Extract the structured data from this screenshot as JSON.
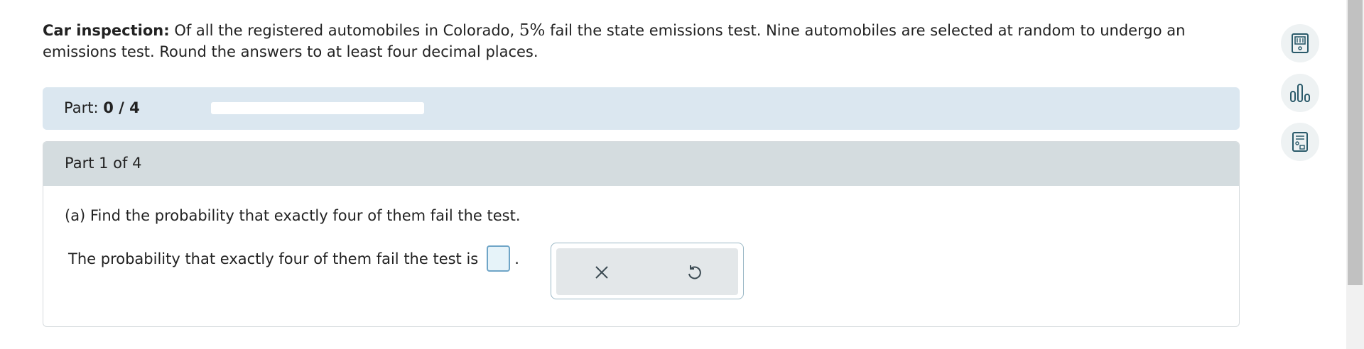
{
  "problem": {
    "title": "Car inspection:",
    "text_before": "Of all the registered automobiles in Colorado,",
    "percent": "5%",
    "text_after": "fail the state emissions test. Nine automobiles are selected at random to undergo an emissions test. Round the answers to at least four decimal places."
  },
  "progress": {
    "label": "Part:",
    "value": "0 / 4",
    "fraction": 0
  },
  "part": {
    "header": "Part 1 of 4",
    "question": "(a) Find the probability that exactly four of them fail the test.",
    "answer_prompt": "The probability that exactly four of them fail the test is",
    "answer_value": "",
    "period": "."
  },
  "tools": {
    "clear_icon": "close-icon",
    "undo_icon": "undo-icon"
  },
  "side_tools": [
    {
      "icon": "ebook-icon"
    },
    {
      "icon": "bar-chart-icon"
    },
    {
      "icon": "calculator-icon"
    }
  ],
  "colors": {
    "progress_bg": "#dbe7f0",
    "header_bg": "#d4dcdf",
    "input_border": "#6fa5c7",
    "input_bg": "#e6f3f9",
    "icon": "#2a5a6a"
  }
}
